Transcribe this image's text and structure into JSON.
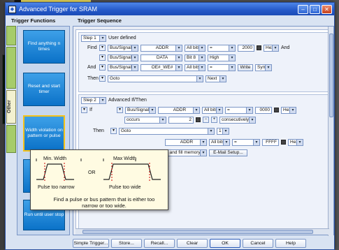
{
  "window": {
    "title": "Advanced Trigger for SRAM"
  },
  "headers": {
    "functions": "Trigger Functions",
    "sequence": "Trigger Sequence"
  },
  "tabs": [
    "Other"
  ],
  "functions": [
    {
      "label": "Find anything n times"
    },
    {
      "label": "Reset and start timer"
    },
    {
      "label": "Width violation on pattern or pulse",
      "selected": true
    },
    {
      "label": ""
    },
    {
      "label": "Run until user stop"
    }
  ],
  "step1": {
    "step_label": "Step 1",
    "name": "User defined",
    "row1": {
      "kw": "Find",
      "type": "Bus/Signal",
      "signal": "ADDR",
      "bits": "All bits",
      "op": "=",
      "value": "2000",
      "fmt": "Hex",
      "conj": "And"
    },
    "row2": {
      "type": "Bus/Signal",
      "signal": "DATA",
      "bits": "Bit 8",
      "op": "High"
    },
    "row3": {
      "kw": "And",
      "type": "Bus/Signal",
      "signal": "OE#_WE#",
      "bits": "All bits",
      "op": "=",
      "btn1": "Write",
      "btn2": "Sym"
    },
    "row4": {
      "kw": "Then",
      "action": "Goto",
      "target": "Next"
    }
  },
  "step2": {
    "step_label": "Step 2",
    "name": "Advanced If/Then",
    "row1": {
      "kw": "If",
      "type": "Bus/Signal",
      "signal": "ADDR",
      "bits": "All bits",
      "op": "=",
      "value": "0000",
      "fmt": "Hex"
    },
    "row2": {
      "occurs": "occurs",
      "count": "2",
      "mode": "consecutively"
    },
    "row3": {
      "kw": "Then",
      "action": "Goto",
      "target": "1"
    },
    "row4": {
      "signal": "ADDR",
      "bits": "All bits",
      "op": "=",
      "value": "FFFF",
      "fmt": "Hex"
    },
    "row5": {
      "action": ", and fill memory",
      "email": "E-Mail Setup..."
    }
  },
  "tooltip": {
    "min_width": "Min. Width",
    "max_width": "Max Width",
    "or": "OR",
    "narrow": "Pulse too narrow",
    "wide": "Pulse too wide",
    "desc": "Find a pulse or bus pattern that is either too narrow or too wide."
  },
  "buttons": {
    "simple": "Simple Trigger...",
    "store": "Store...",
    "recall": "Recall...",
    "clear": "Clear",
    "ok": "OK",
    "cancel": "Cancel",
    "help": "Help"
  }
}
